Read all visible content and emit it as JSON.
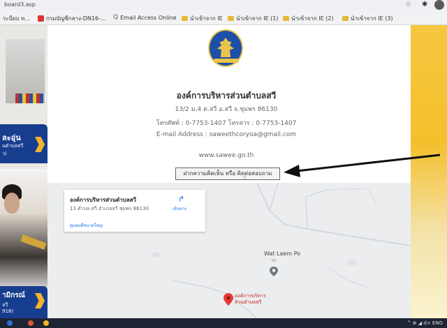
{
  "browser": {
    "url": "board3.asp",
    "bookmarks": [
      {
        "icon": "page-icon",
        "label": "ระบียบ ท..."
      },
      {
        "icon": "red-bookmark-icon",
        "label": "กรมบัญชีกลาง-DN16-..."
      },
      {
        "icon": "search-icon",
        "label": "Email Access Online"
      },
      {
        "icon": "folder-icon",
        "label": "นำเข้าจาก IE"
      },
      {
        "icon": "folder-icon",
        "label": "นำเข้าจาก IE (1)"
      },
      {
        "icon": "folder-icon",
        "label": "นำเข้าจาก IE (2)"
      },
      {
        "icon": "folder-icon",
        "label": "นำเข้าจาก IE (3)"
      }
    ]
  },
  "sidebar": {
    "banner1": {
      "line1": "ละอุ่น",
      "line2": "นตำบลสวี",
      "line3": "ว)"
    },
    "banner2": {
      "line1": "ามิกรณ์",
      "line2": "ลวี",
      "line3": "918)"
    }
  },
  "header": {
    "org_name": "องค์การบริหารส่วนตำบลสวี",
    "address": "13/2 ม.4 ต.สวี อ.สวี จ.ชุมพร 86130",
    "phone": "โทรศัพท์ : 0-7753-1407 โทรสาร : 0-7753-1407",
    "email": "E-mail Address : saweethcoryoa@gmail.com",
    "website": "www.sawee.go.th",
    "contact_button": "ฝากความคิดเห็น หรือ ติดต่อสอบถาม"
  },
  "map": {
    "card": {
      "name": "องค์การบริหารส่วนตำบลสวี",
      "address": "13 ตำบล สวี อำเภอสวี ชุมพร 86130",
      "directions": "เส้นทาง",
      "larger_map": "ดูแผนที่ขนาดใหญ่"
    },
    "poi_name": "Wat Laem Po",
    "poi_sub": "วัด",
    "pin_label_line1": "องค์การบริหาร",
    "pin_label_line2": "ส่วนตำบลสวี"
  },
  "taskbar": {
    "tray_text": "^ ⊕ ◢ d× ENG"
  },
  "colors": {
    "sidebar_banner": "#173d8e",
    "accent_yellow": "#f5bf2c",
    "map_link": "#1a73e8",
    "pin_red": "#c5221f"
  }
}
